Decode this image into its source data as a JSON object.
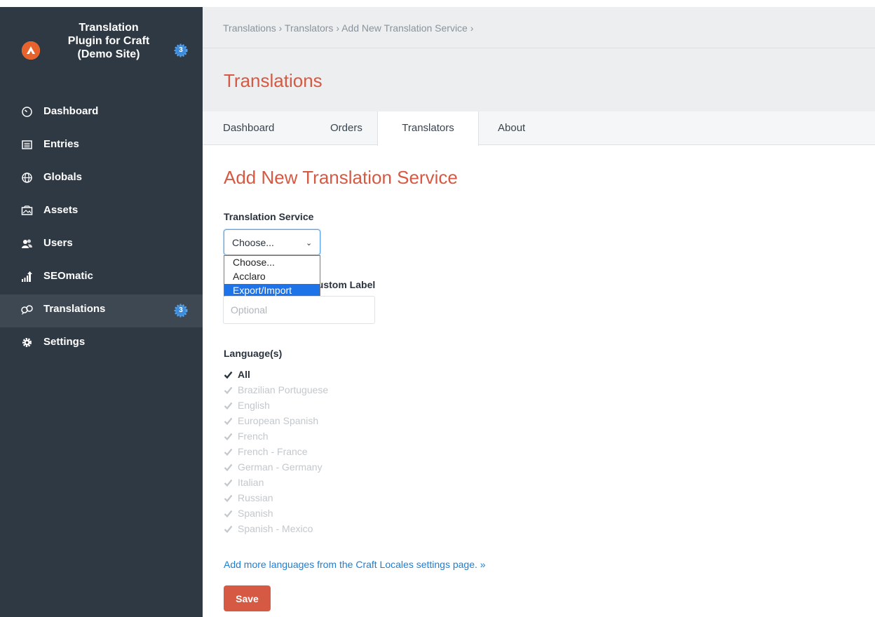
{
  "site": {
    "name": "Translation Plugin for Craft (Demo Site)",
    "badge_count": "3"
  },
  "nav": [
    {
      "label": "Dashboard",
      "icon": "dashboard-icon"
    },
    {
      "label": "Entries",
      "icon": "entries-icon"
    },
    {
      "label": "Globals",
      "icon": "globe-icon"
    },
    {
      "label": "Assets",
      "icon": "assets-icon"
    },
    {
      "label": "Users",
      "icon": "users-icon"
    },
    {
      "label": "SEOmatic",
      "icon": "seomatic-icon"
    },
    {
      "label": "Translations",
      "icon": "translations-icon",
      "active": true,
      "badge": "3"
    },
    {
      "label": "Settings",
      "icon": "gear-icon"
    }
  ],
  "breadcrumb": "Translations › Translators › Add New Translation Service ›",
  "page_title": "Translations",
  "tabs": [
    {
      "label": "Dashboard"
    },
    {
      "label": "Orders"
    },
    {
      "label": "Translators",
      "active": true
    },
    {
      "label": "About"
    }
  ],
  "form": {
    "heading": "Add New Translation Service",
    "service_label": "Translation Service",
    "service_value": "Choose...",
    "service_options": [
      "Choose...",
      "Acclaro",
      "Export/Import"
    ],
    "highlighted_option": "Export/Import",
    "custom_label_visible": "e Custom Label",
    "custom_label_placeholder": "Optional",
    "languages_label": "Language(s)",
    "all_label": "All",
    "languages": [
      "Brazilian Portuguese",
      "English",
      "European Spanish",
      "French",
      "French - France",
      "German - Germany",
      "Italian",
      "Russian",
      "Spanish",
      "Spanish - Mexico"
    ],
    "add_link": "Add more languages from the Craft Locales settings page. »",
    "save_label": "Save"
  },
  "colors": {
    "accent": "#d65a43",
    "sidebar": "#2f3944",
    "link": "#1b7fd8",
    "badge": "#3d8bd8"
  }
}
